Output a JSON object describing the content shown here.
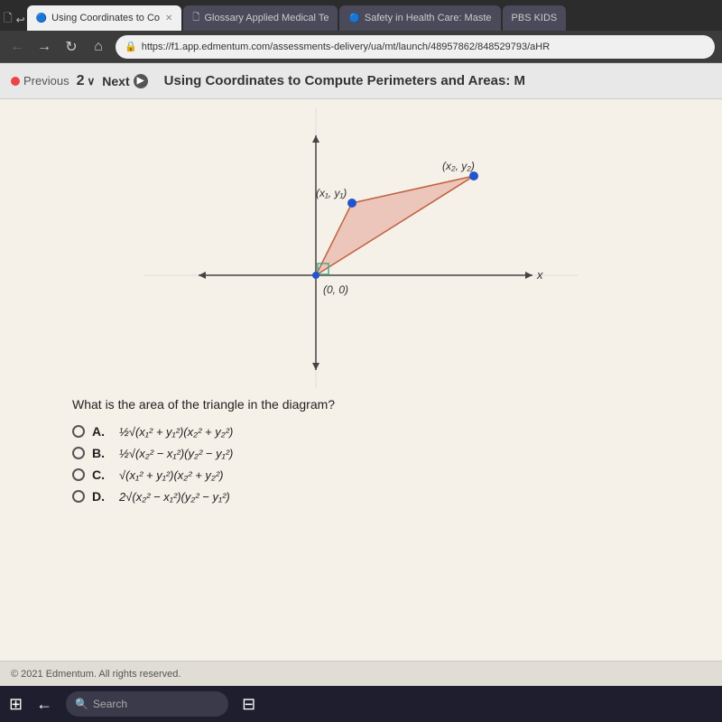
{
  "browser": {
    "tabs": [
      {
        "id": "tab1",
        "label": "Using Coordinates to Co",
        "active": true,
        "icon": "🔵"
      },
      {
        "id": "tab2",
        "label": "Glossary Applied Medical Te",
        "active": false,
        "icon": "🗋"
      },
      {
        "id": "tab3",
        "label": "Safety in Health Care: Maste",
        "active": false,
        "icon": "🔵"
      },
      {
        "id": "tab4",
        "label": "PBS KIDS",
        "active": false,
        "icon": "🎮"
      }
    ],
    "url": "https://f1.app.edmentum.com/assessments-delivery/ua/mt/launch/48957862/848529793/aHR",
    "nav": {
      "back": "←",
      "forward": "→",
      "refresh": "↻",
      "home": "⌂"
    }
  },
  "toolbar": {
    "previous_label": "Previous",
    "question_number": "2",
    "chevron": "∨",
    "next_label": "Next",
    "title": "Using Coordinates to Compute Perimeters and Areas: M"
  },
  "graph": {
    "origin_label": "(0, 0)",
    "point1_label": "(x₁, y₁)",
    "point2_label": "(x₂, y₂)",
    "axis_x": "x"
  },
  "question": {
    "text": "What is the area of the triangle in the diagram?"
  },
  "answers": [
    {
      "id": "A",
      "label": "A.",
      "expr": "½√(x₁² + y₁²)(x₂² + y₂²)"
    },
    {
      "id": "B",
      "label": "B.",
      "expr": "½√(x₂² − x₁²)(y₂² − y₁²)"
    },
    {
      "id": "C",
      "label": "C.",
      "expr": "√(x₁² + y₁²)(x₂² + y₂²)"
    },
    {
      "id": "D",
      "label": "D.",
      "expr": "2√(x₂² − x₁²)(y₂² − y₁²)"
    }
  ],
  "footer": {
    "text": "© 2021 Edmentum. All rights reserved."
  },
  "taskbar": {
    "search_placeholder": "Search"
  }
}
